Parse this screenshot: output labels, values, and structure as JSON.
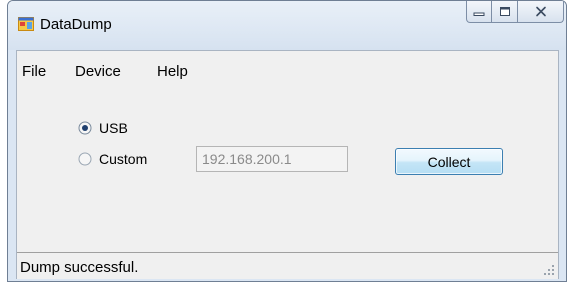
{
  "window": {
    "title": "DataDump",
    "icon": "app-window-icon",
    "caption_buttons": [
      "minimize-icon",
      "maximize-icon",
      "close-icon"
    ]
  },
  "menu": {
    "items": [
      "File",
      "Device",
      "Help"
    ]
  },
  "connection": {
    "options": [
      {
        "label": "USB",
        "selected": true
      },
      {
        "label": "Custom",
        "selected": false
      }
    ],
    "ip_value": "192.168.200.1",
    "collect_label": "Collect"
  },
  "status": {
    "text": "Dump successful."
  },
  "colors": {
    "accent": "#3c7fb1",
    "frame": "#dbe6f3",
    "client": "#f0f0f0"
  }
}
